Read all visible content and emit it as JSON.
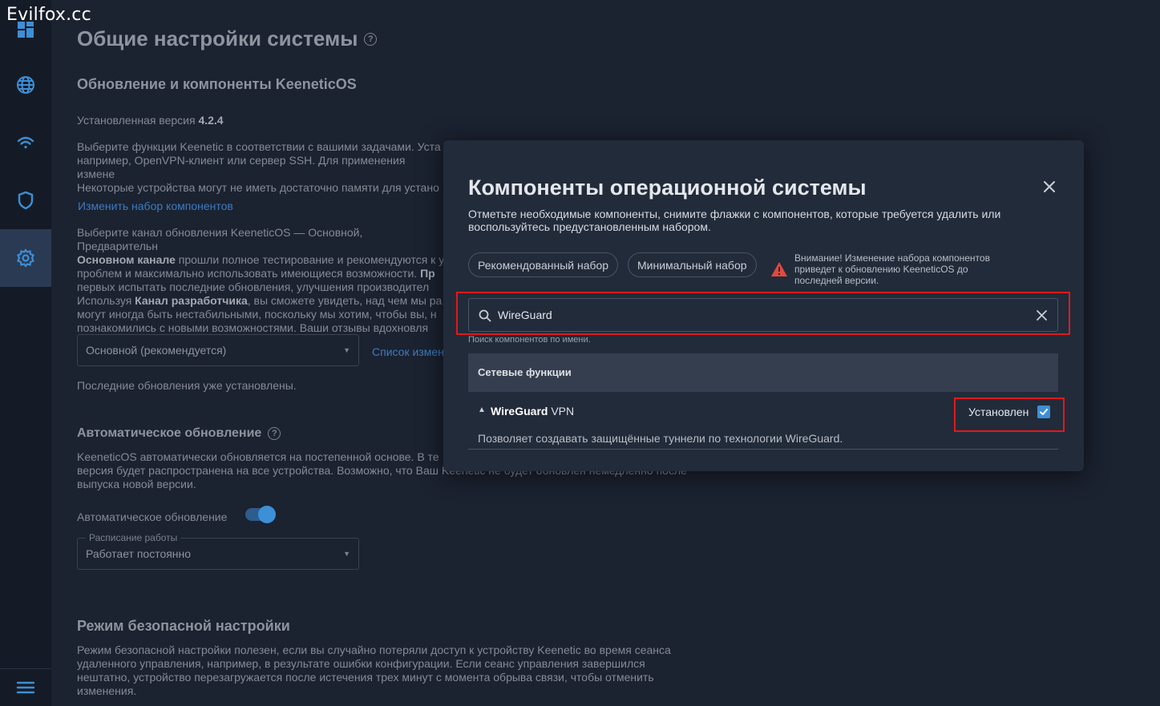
{
  "watermark": "Evilfox.cc",
  "sidebar": {
    "items": [
      {
        "icon": "dashboard-icon"
      },
      {
        "icon": "globe-icon"
      },
      {
        "icon": "wifi-icon"
      },
      {
        "icon": "shield-icon"
      },
      {
        "icon": "gear-icon",
        "active": true
      },
      {
        "icon": "menu-icon"
      }
    ]
  },
  "page": {
    "title": "Общие настройки системы",
    "update_section": {
      "title": "Обновление и компоненты KeeneticOS",
      "installed_version_label": "Установленная версия",
      "installed_version": "4.2.4",
      "components_text_1": "Выберите функции Keenetic в соответствии с вашими задачами. Уста",
      "components_text_2": "например, OpenVPN-клиент или сервер SSH. Для применения измене",
      "components_text_3": "Некоторые устройства могут не иметь достаточно памяти для устано",
      "change_components_link": "Изменить набор компонентов",
      "channel_text_1": "Выберите канал обновления KeeneticOS — Основной, Предварительн",
      "channel_text_2_bold": "Основном канале",
      "channel_text_2": " прошли полное тестирование и рекомендуются к у",
      "channel_text_3": "проблем и максимально использовать имеющиеся возможности. ",
      "channel_text_3_bold": "Пр",
      "channel_text_4": "первых испытать последние обновления, улучшения производител",
      "channel_text_5a": "Используя ",
      "channel_text_5_bold": "Канал разработчика",
      "channel_text_5b": ", вы сможете увидеть, над чем мы ра",
      "channel_text_6": "могут иногда быть нестабильными, поскольку мы хотим, чтобы вы, н",
      "channel_text_7": "познакомились с новыми возможностями. Ваши отзывы вдохновля",
      "channel_select_value": "Основной (рекомендуется)",
      "changes_list_link": "Список измен",
      "status_text": "Последние обновления уже установлены."
    },
    "auto_update": {
      "title": "Автоматическое обновление",
      "text_1": "KeeneticOS автоматически обновляется на постепенной основе. В те",
      "text_2": "версия будет распространена на все устройства. Возможно, что Ваш Keenetic не будет обновлен немедленно после",
      "text_3": "выпуска новой версии.",
      "toggle_label": "Автоматическое обновление",
      "toggle_on": true,
      "schedule_legend": "Расписание работы",
      "schedule_value": "Работает постоянно"
    },
    "safe_mode": {
      "title": "Режим безопасной настройки",
      "text_1": "Режим безопасной настройки полезен, если вы случайно потеряли доступ к устройству Keenetic во время сеанса",
      "text_2": "удаленного управления, например, в результате ошибки конфигурации. Если сеанс управления завершился",
      "text_3": "нештатно, устройство перезагружается после истечения трех минут с момента обрыва связи, чтобы отменить",
      "text_4": "изменения."
    }
  },
  "modal": {
    "title": "Компоненты операционной системы",
    "description": "Отметьте необходимые компоненты, снимите флажки с компонентов, которые требуется удалить или воспользуйтесь предустановленным набором.",
    "recommended_button": "Рекомендованный набор",
    "minimal_button": "Минимальный набор",
    "warning": "Внимание! Изменение набора компонентов приведет к обновлению KeeneticOS до последней версии.",
    "search": {
      "value": "WireGuard",
      "hint": "Поиск компонентов по имени."
    },
    "section_title": "Сетевые функции",
    "component": {
      "name_bold": "WireGuard",
      "name_rest": " VPN",
      "description": "Позволяет создавать защищённые туннели по технологии WireGuard.",
      "status_label": "Установлен",
      "checked": true
    },
    "colors": {
      "accent": "#3d8fd6",
      "highlight": "#e0191b",
      "warning": "#e04a3c"
    }
  }
}
